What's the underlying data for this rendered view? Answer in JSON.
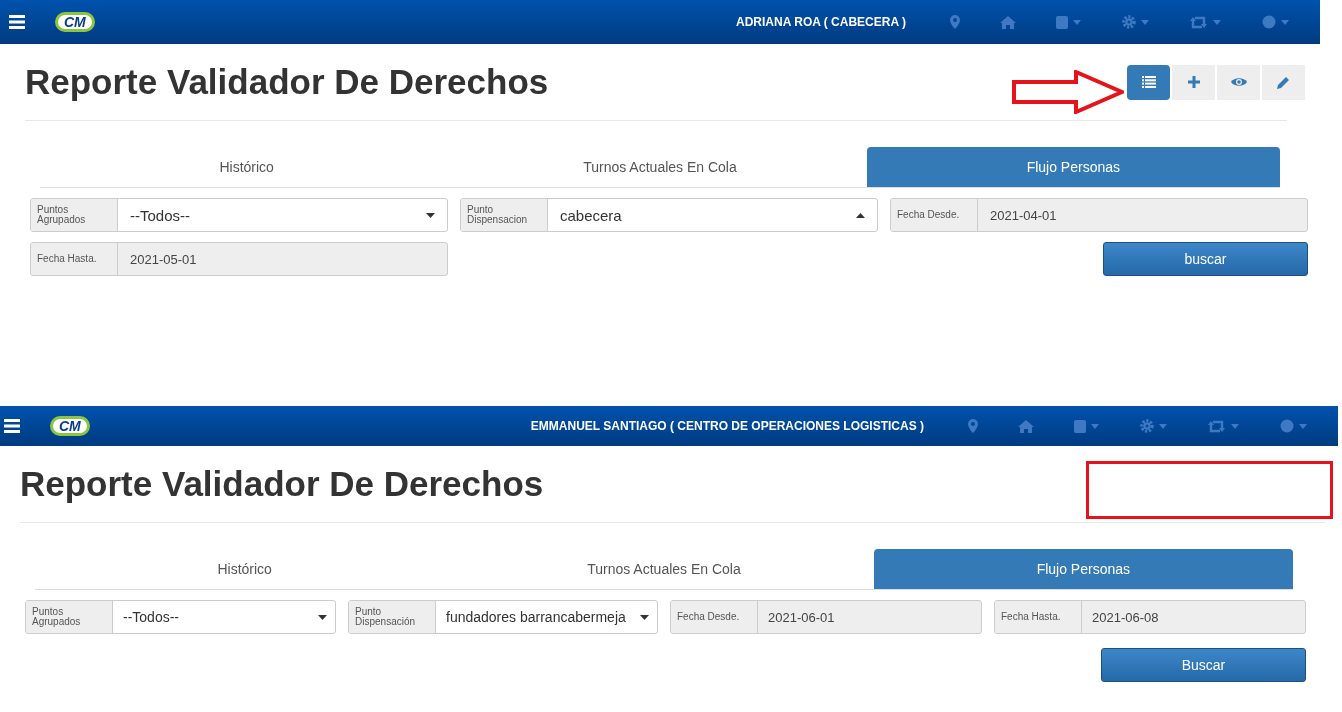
{
  "panels": [
    {
      "navbar": {
        "logo": "CM",
        "user": "ADRIANA ROA ( CABECERA )"
      },
      "title": "Reporte Validador De Derechos",
      "annotation": {
        "kind": "arrow"
      },
      "toolbar": [
        {
          "kind": "list",
          "selected": true
        },
        {
          "kind": "plus",
          "selected": false
        },
        {
          "kind": "eye",
          "selected": false
        },
        {
          "kind": "pencil",
          "selected": false
        }
      ],
      "tabs": [
        {
          "label": "Histórico",
          "selected": false
        },
        {
          "label": "Turnos Actuales En Cola",
          "selected": false
        },
        {
          "label": "Flujo Personas",
          "selected": true
        }
      ],
      "filters": [
        {
          "kind": "select",
          "label": "Puntos Agrupados",
          "value": "--Todos--",
          "expanded": false
        },
        {
          "kind": "select",
          "label": "Punto Dispensacion",
          "value": "cabecera",
          "expanded": true
        },
        {
          "kind": "date",
          "label": "Fecha Desde.",
          "value": "2021-04-01"
        },
        {
          "kind": "date",
          "label": "Fecha Hasta.",
          "value": "2021-05-01"
        }
      ],
      "search_button": "buscar"
    },
    {
      "navbar": {
        "logo": "CM",
        "user": "EMMANUEL SANTIAGO ( CENTRO DE OPERACIONES LOGISTICAS )"
      },
      "title": "Reporte Validador De Derechos",
      "annotation": {
        "kind": "box"
      },
      "tabs": [
        {
          "label": "Histórico",
          "selected": false
        },
        {
          "label": "Turnos Actuales En Cola",
          "selected": false
        },
        {
          "label": "Flujo Personas",
          "selected": true
        }
      ],
      "filters": [
        {
          "kind": "select",
          "label": "Puntos Agrupados",
          "value": "--Todos--",
          "expanded": false
        },
        {
          "kind": "select",
          "label": "Punto Dispensación",
          "value": "fundadores barrancabermeja",
          "expanded": false
        },
        {
          "kind": "date",
          "label": "Fecha Desde.",
          "value": "2021-06-01"
        },
        {
          "kind": "date",
          "label": "Fecha Hasta.",
          "value": "2021-06-08"
        }
      ],
      "search_button": "Buscar"
    }
  ]
}
